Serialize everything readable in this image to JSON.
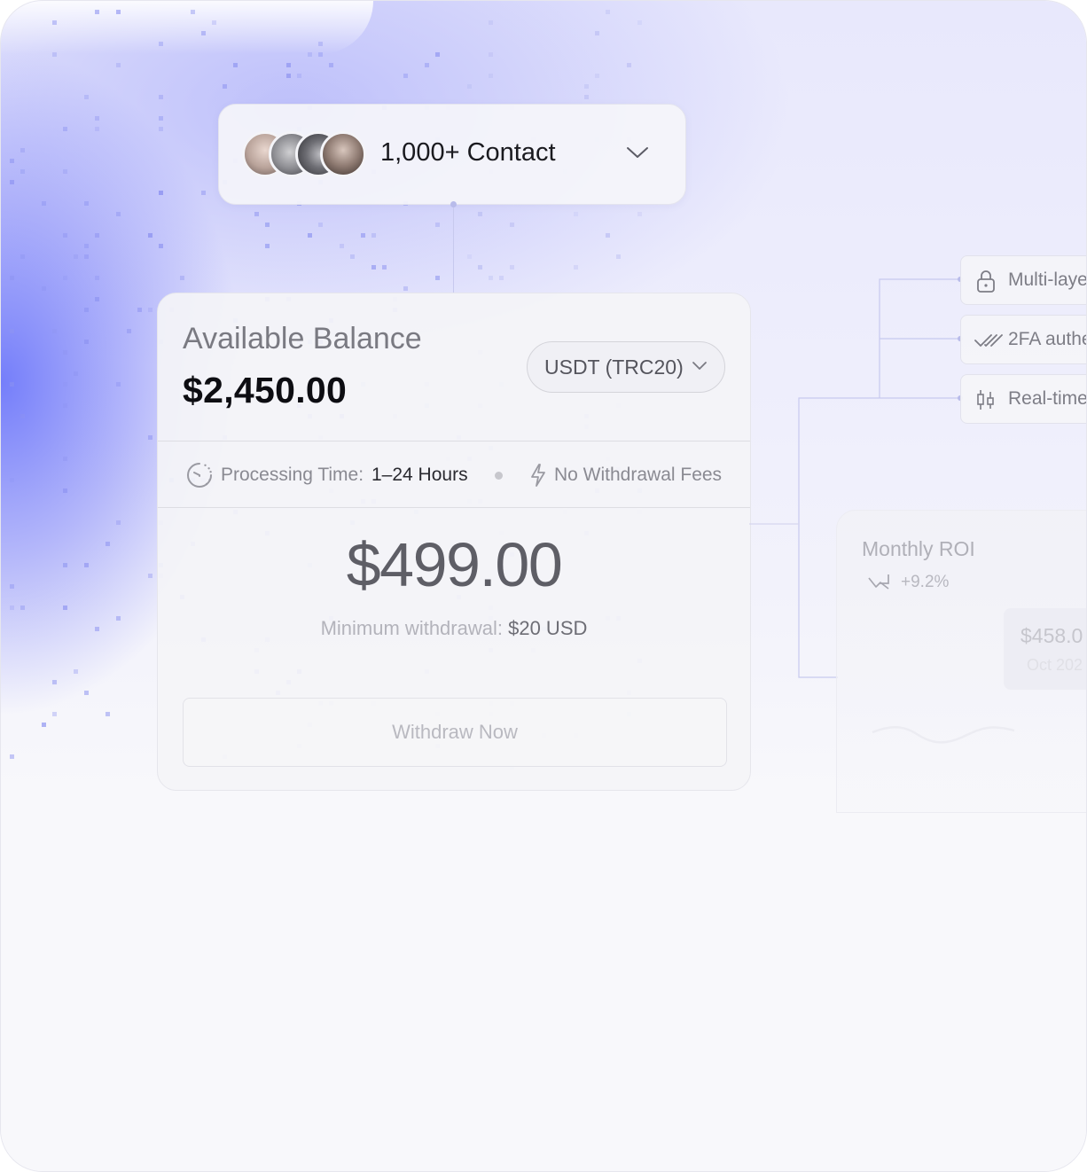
{
  "contacts": {
    "label": "1,000+ Contact",
    "avatar_count": 4
  },
  "balance_card": {
    "balance_label": "Available Balance",
    "balance_amount": "$2,450.00",
    "currency": "USDT (TRC20)",
    "processing_label": "Processing Time:",
    "processing_value": "1–24 Hours",
    "fees_label": "No Withdrawal Fees",
    "withdraw_amount": "$499.00",
    "minimum_label": "Minimum withdrawal:",
    "minimum_value": "$20 USD",
    "withdraw_button": "Withdraw Now"
  },
  "features": [
    {
      "icon": "lock-icon",
      "label": "Multi-laye"
    },
    {
      "icon": "double-check-icon",
      "label": "2FA authe"
    },
    {
      "icon": "candlestick-icon",
      "label": "Real-time"
    }
  ],
  "roi_card": {
    "title": "Monthly ROI",
    "change": "+9.2%",
    "tooltip_value": "$458.0",
    "tooltip_date": "Oct 202"
  },
  "colors": {
    "accent": "#6f78f7",
    "connector": "#c7c9ee"
  }
}
